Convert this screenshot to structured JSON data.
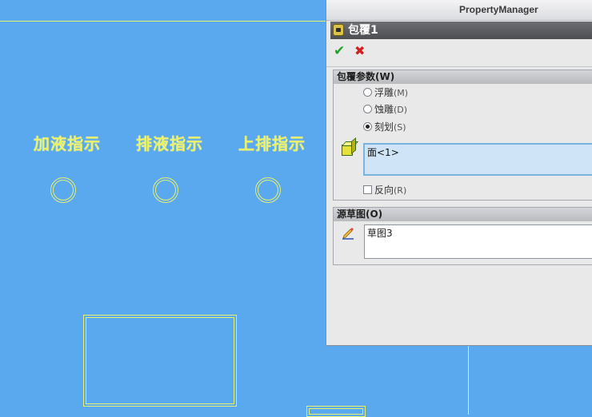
{
  "canvas": {
    "engravings": [
      "加液指示",
      "排液指示",
      "上排指示"
    ]
  },
  "property_manager": {
    "title": "PropertyManager",
    "feature_name": "包覆1",
    "ok_symbol": "✔",
    "cancel_symbol": "✖",
    "wrap_params": {
      "header": "包覆参数(W)",
      "options": [
        {
          "label": "浮雕",
          "hotkey": "(M)",
          "selected": false
        },
        {
          "label": "蚀雕",
          "hotkey": "(D)",
          "selected": false
        },
        {
          "label": "刻划",
          "hotkey": "(S)",
          "selected": true
        }
      ],
      "face_selection": "面<1>",
      "reverse_label": "反向",
      "reverse_hotkey": "(R)",
      "reverse_checked": false
    },
    "source_sketch": {
      "header": "源草图(O)",
      "value": "草图3"
    }
  },
  "colors": {
    "viewport_bg": "#5aa9ee",
    "edge_line": "#e8f070",
    "panel_bg": "#e9e9ea",
    "selection_bg": "#cfe5f7"
  },
  "icons": {
    "feature": "wrap-feature-icon",
    "ok": "checkmark-icon",
    "cancel": "close-icon",
    "face": "face-cube-icon",
    "sketch": "sketch-pencil-icon"
  }
}
